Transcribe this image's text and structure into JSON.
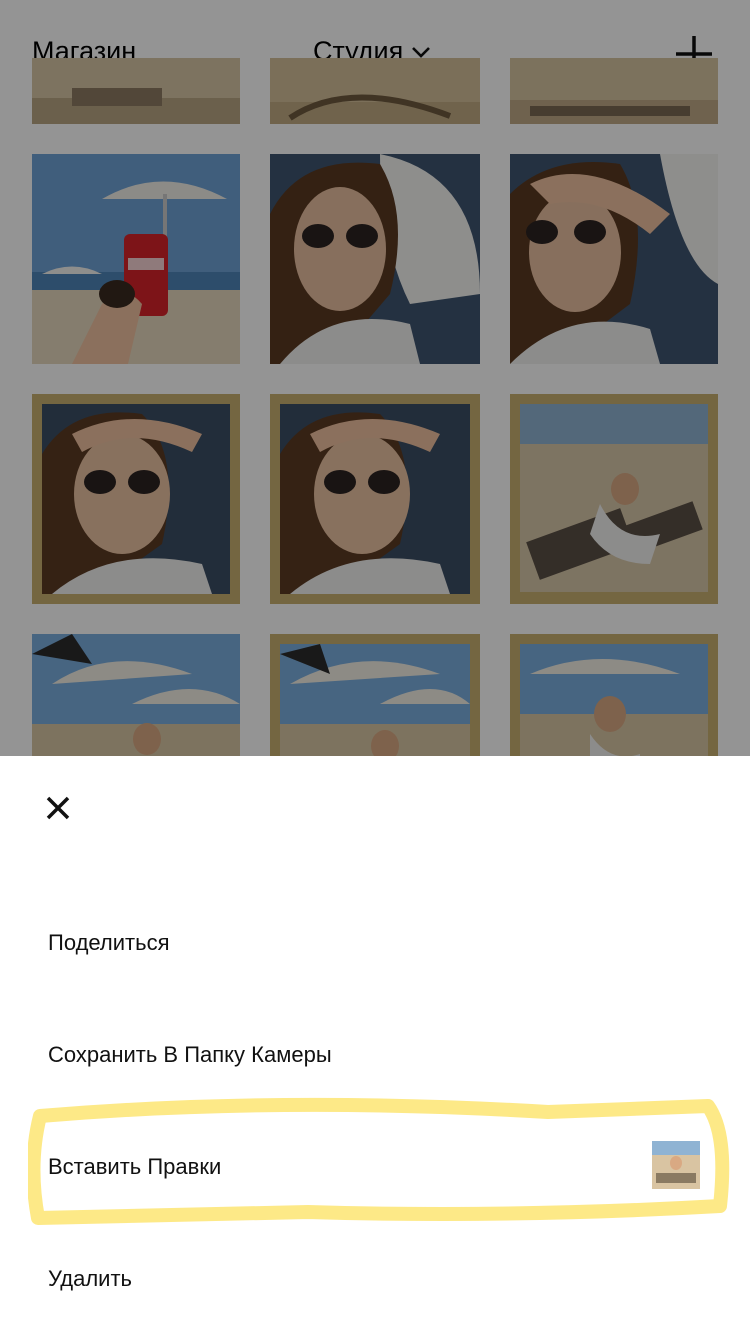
{
  "header": {
    "store_label": "Магазин",
    "studio_label": "Студия",
    "add_icon": "plus-icon",
    "dropdown_icon": "chevron-down-icon"
  },
  "grid": {
    "photos": [
      "beach-top-left",
      "beach-top-center",
      "beach-top-right",
      "coca-cola-sunglasses",
      "woman-sunglasses-pillow",
      "woman-hand-on-head",
      "woman-sunglasses-framed",
      "woman-sunglasses-framed-2",
      "beach-lounger-framed",
      "beach-umbrellas-1",
      "beach-umbrellas-2",
      "beach-umbrellas-3"
    ]
  },
  "sheet": {
    "close_icon": "close-icon",
    "actions": [
      {
        "label": "Поделиться"
      },
      {
        "label": "Сохранить В Папку Камеры"
      },
      {
        "label": "Вставить Правки"
      },
      {
        "label": "Удалить"
      }
    ],
    "highlight_color": "#fde77a"
  }
}
